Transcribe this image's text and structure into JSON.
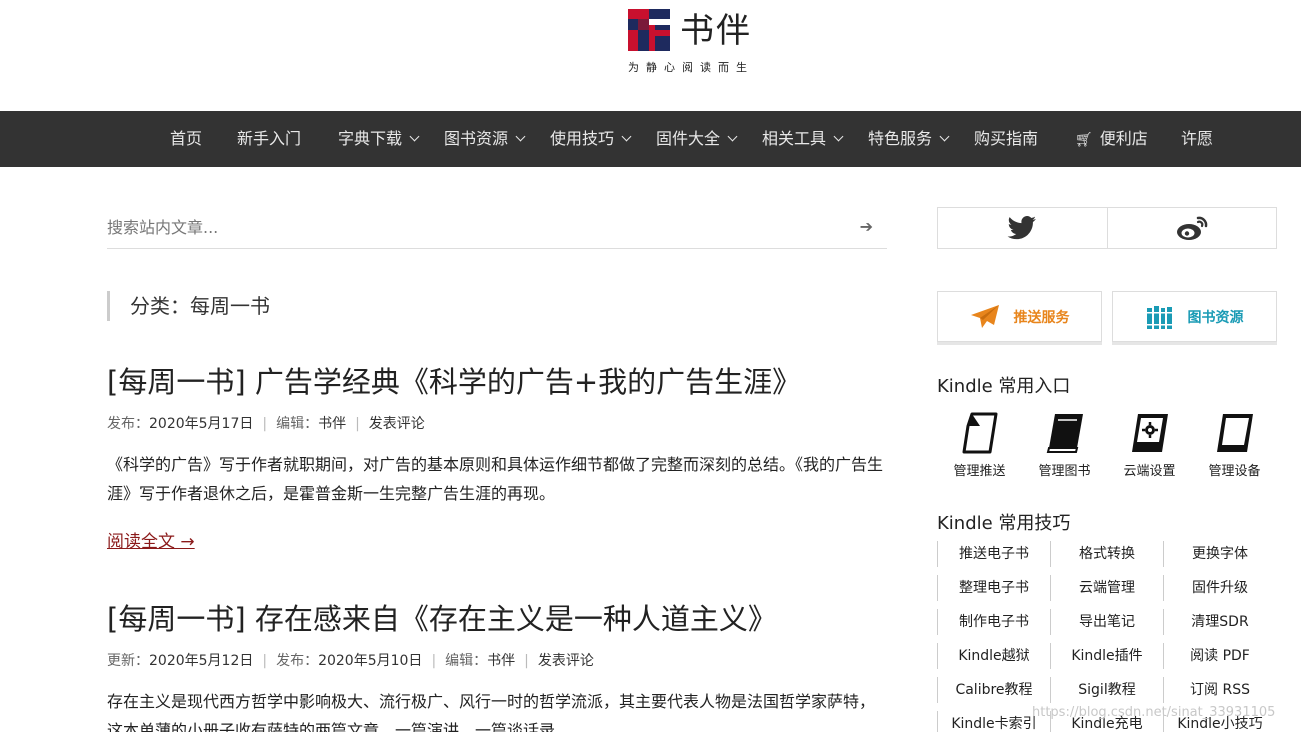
{
  "site": {
    "name": "书伴",
    "tagline": "为静心阅读而生"
  },
  "nav": {
    "items": [
      {
        "label": "首页"
      },
      {
        "label": "新手入门"
      },
      {
        "label": "字典下载"
      },
      {
        "label": "图书资源"
      },
      {
        "label": "使用技巧"
      },
      {
        "label": "固件大全"
      },
      {
        "label": "相关工具"
      },
      {
        "label": "特色服务"
      },
      {
        "label": "购买指南"
      },
      {
        "label": "便利店"
      },
      {
        "label": "许愿"
      }
    ]
  },
  "search": {
    "placeholder": "搜索站内文章..."
  },
  "category": {
    "label": "分类：每周一书"
  },
  "posts": [
    {
      "title": "[每周一书] 广告学经典《科学的广告+我的广告生涯》",
      "published_label": "发布：",
      "published": "2020年5月17日",
      "editor_label": "编辑：",
      "editor": "书伴",
      "comment": "发表评论",
      "excerpt": "《科学的广告》写于作者就职期间，对广告的基本原则和具体运作细节都做了完整而深刻的总结。《我的广告生涯》写于作者退休之后，是霍普金斯一生完整广告生涯的再现。",
      "read_more": "阅读全文 →"
    },
    {
      "title": "[每周一书] 存在感来自《存在主义是一种人道主义》",
      "updated_label": "更新：",
      "updated": "2020年5月12日",
      "published_label": "发布：",
      "published": "2020年5月10日",
      "editor_label": "编辑：",
      "editor": "书伴",
      "comment": "发表评论",
      "excerpt": "存在主义是现代西方哲学中影响极大、流行极广、风行一时的哲学流派，其主要代表人物是法国哲学家萨特，这本单薄的小册子收有萨特的两篇文章，一篇演讲，一篇谈话录。"
    }
  ],
  "sidebar": {
    "services": [
      {
        "label": "推送服务",
        "color": "#e8851c"
      },
      {
        "label": "图书资源",
        "color": "#1a9bb5"
      }
    ],
    "kindle_entries_title": "Kindle 常用入口",
    "kindle_entries": [
      {
        "label": "管理推送",
        "icon": "document-icon"
      },
      {
        "label": "管理图书",
        "icon": "book-icon"
      },
      {
        "label": "云端设置",
        "icon": "gear-device-icon"
      },
      {
        "label": "管理设备",
        "icon": "kindle-device-icon"
      }
    ],
    "kindle_tips_title": "Kindle 常用技巧",
    "kindle_tips": [
      "推送电子书",
      "格式转换",
      "更换字体",
      "整理电子书",
      "云端管理",
      "固件升级",
      "制作电子书",
      "导出笔记",
      "清理SDR",
      "Kindle越狱",
      "Kindle插件",
      "阅读 PDF",
      "Calibre教程",
      "Sigil教程",
      "订阅 RSS",
      "Kindle卡索引",
      "Kindle充电",
      "Kindle小技巧"
    ]
  },
  "watermark": "https://blog.csdn.net/sinat_33931105",
  "colors": {
    "nav_bg": "#333333",
    "read_more": "#8b1a1a",
    "logo_red": "#c8102e",
    "logo_navy": "#1e2a5e"
  }
}
